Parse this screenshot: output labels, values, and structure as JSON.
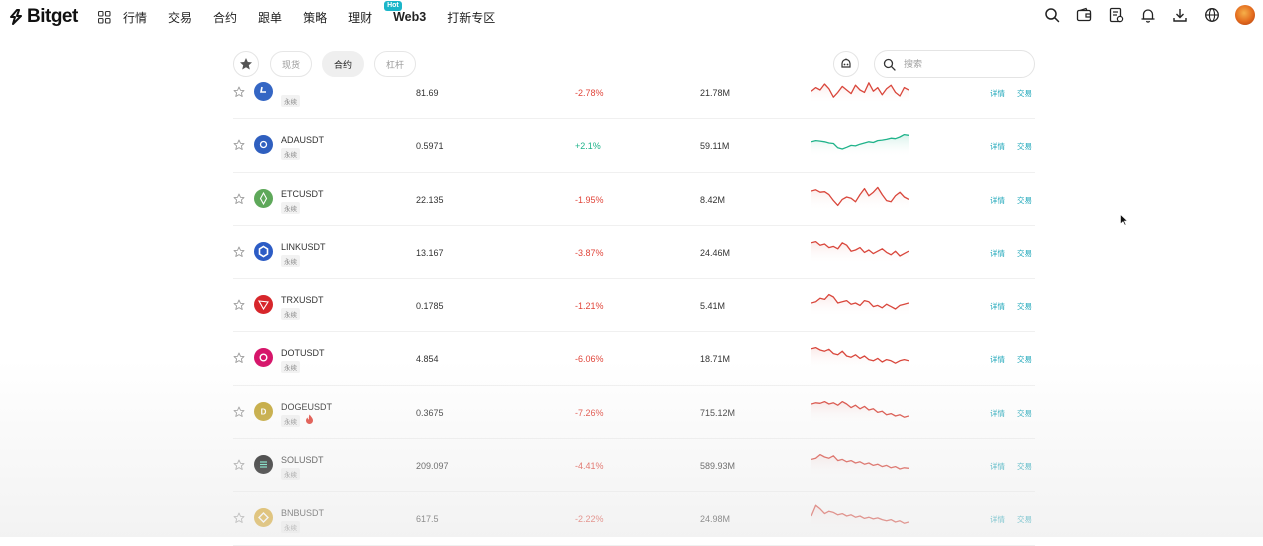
{
  "nav": {
    "brand": "Bitget",
    "items": [
      {
        "label": "行情"
      },
      {
        "label": "交易"
      },
      {
        "label": "合约"
      },
      {
        "label": "跟单"
      },
      {
        "label": "策略"
      },
      {
        "label": "理财"
      },
      {
        "label": "Web3",
        "badge": "Hot"
      },
      {
        "label": "打新专区"
      }
    ],
    "right_icons": [
      "search-icon",
      "wallet-icon",
      "orders-icon",
      "bell-icon",
      "download-icon",
      "globe-icon"
    ]
  },
  "filters": {
    "tabs": [
      {
        "label": "现货",
        "active": false
      },
      {
        "label": "合约",
        "active": true
      },
      {
        "label": "杠杆",
        "active": false
      }
    ],
    "search_placeholder": "搜索"
  },
  "actions": {
    "detail": "详情",
    "trade": "交易"
  },
  "rows": [
    {
      "symbol": "",
      "tag": "永续",
      "price": "81.69",
      "change": "-2.78%",
      "direction": "down",
      "volume": "21.78M",
      "icon_color": "#3466c4",
      "coin_icon": "litecoin-icon",
      "hot": false,
      "spark": [
        0.45,
        0.6,
        0.5,
        0.75,
        0.55,
        0.2,
        0.4,
        0.65,
        0.5,
        0.35,
        0.7,
        0.5,
        0.4,
        0.8,
        0.45,
        0.6,
        0.3,
        0.55,
        0.7,
        0.4,
        0.25,
        0.6,
        0.5
      ]
    },
    {
      "symbol": "ADAUSDT",
      "tag": "永续",
      "price": "0.5971",
      "change": "+2.1%",
      "direction": "up",
      "volume": "59.11M",
      "icon_color": "#2f5fbf",
      "coin_icon": "cardano-icon",
      "hot": false,
      "spark": [
        0.55,
        0.6,
        0.58,
        0.55,
        0.5,
        0.48,
        0.3,
        0.25,
        0.32,
        0.4,
        0.38,
        0.45,
        0.5,
        0.55,
        0.52,
        0.6,
        0.62,
        0.65,
        0.7,
        0.68,
        0.75,
        0.85,
        0.82
      ]
    },
    {
      "symbol": "ETCUSDT",
      "tag": "永续",
      "price": "22.135",
      "change": "-1.95%",
      "direction": "down",
      "volume": "8.42M",
      "icon_color": "#5ea85a",
      "coin_icon": "ethereum-classic-icon",
      "hot": false,
      "spark": [
        0.75,
        0.8,
        0.7,
        0.72,
        0.6,
        0.35,
        0.15,
        0.4,
        0.5,
        0.45,
        0.3,
        0.6,
        0.85,
        0.55,
        0.7,
        0.9,
        0.6,
        0.35,
        0.3,
        0.55,
        0.7,
        0.5,
        0.4
      ]
    },
    {
      "symbol": "LINKUSDT",
      "tag": "永续",
      "price": "13.167",
      "change": "-3.87%",
      "direction": "down",
      "volume": "24.46M",
      "icon_color": "#2c5cc5",
      "coin_icon": "chainlink-icon",
      "hot": false,
      "spark": [
        0.8,
        0.85,
        0.7,
        0.75,
        0.6,
        0.65,
        0.55,
        0.8,
        0.7,
        0.45,
        0.5,
        0.6,
        0.4,
        0.5,
        0.35,
        0.45,
        0.55,
        0.4,
        0.3,
        0.45,
        0.25,
        0.35,
        0.45
      ]
    },
    {
      "symbol": "TRXUSDT",
      "tag": "永续",
      "price": "0.1785",
      "change": "-1.21%",
      "direction": "down",
      "volume": "5.41M",
      "icon_color": "#d7262b",
      "coin_icon": "tron-icon",
      "hot": false,
      "spark": [
        0.5,
        0.55,
        0.7,
        0.65,
        0.85,
        0.75,
        0.5,
        0.55,
        0.6,
        0.45,
        0.5,
        0.4,
        0.6,
        0.55,
        0.35,
        0.4,
        0.3,
        0.45,
        0.35,
        0.25,
        0.4,
        0.45,
        0.5
      ]
    },
    {
      "symbol": "DOTUSDT",
      "tag": "永续",
      "price": "4.854",
      "change": "-6.06%",
      "direction": "down",
      "volume": "18.71M",
      "icon_color": "#d6156a",
      "coin_icon": "polkadot-icon",
      "hot": false,
      "spark": [
        0.8,
        0.85,
        0.75,
        0.7,
        0.78,
        0.6,
        0.55,
        0.7,
        0.5,
        0.45,
        0.55,
        0.4,
        0.5,
        0.35,
        0.3,
        0.4,
        0.25,
        0.35,
        0.3,
        0.2,
        0.3,
        0.35,
        0.3
      ]
    },
    {
      "symbol": "DOGEUSDT",
      "tag": "永续",
      "price": "0.3675",
      "change": "-7.26%",
      "direction": "down",
      "volume": "715.12M",
      "icon_color": "#c3a634",
      "coin_icon": "dogecoin-icon",
      "hot": true,
      "spark": [
        0.75,
        0.8,
        0.78,
        0.85,
        0.75,
        0.8,
        0.7,
        0.85,
        0.75,
        0.6,
        0.7,
        0.55,
        0.65,
        0.5,
        0.55,
        0.4,
        0.45,
        0.3,
        0.35,
        0.25,
        0.3,
        0.2,
        0.25
      ]
    },
    {
      "symbol": "SOLUSDT",
      "tag": "永续",
      "price": "209.097",
      "change": "-4.41%",
      "direction": "down",
      "volume": "589.93M",
      "icon_color": "#111111",
      "coin_icon": "solana-icon",
      "hot": false,
      "spark": [
        0.65,
        0.7,
        0.85,
        0.75,
        0.7,
        0.8,
        0.6,
        0.65,
        0.55,
        0.6,
        0.5,
        0.55,
        0.45,
        0.5,
        0.4,
        0.45,
        0.35,
        0.4,
        0.3,
        0.35,
        0.25,
        0.3,
        0.28
      ]
    },
    {
      "symbol": "BNBUSDT",
      "tag": "永续",
      "price": "617.5",
      "change": "-2.22%",
      "direction": "down",
      "volume": "24.98M",
      "icon_color": "#d8a420",
      "coin_icon": "bnb-icon",
      "hot": false,
      "spark": [
        0.5,
        0.95,
        0.8,
        0.6,
        0.7,
        0.65,
        0.55,
        0.6,
        0.5,
        0.55,
        0.45,
        0.5,
        0.4,
        0.45,
        0.38,
        0.42,
        0.35,
        0.3,
        0.35,
        0.25,
        0.3,
        0.2,
        0.25
      ]
    }
  ]
}
